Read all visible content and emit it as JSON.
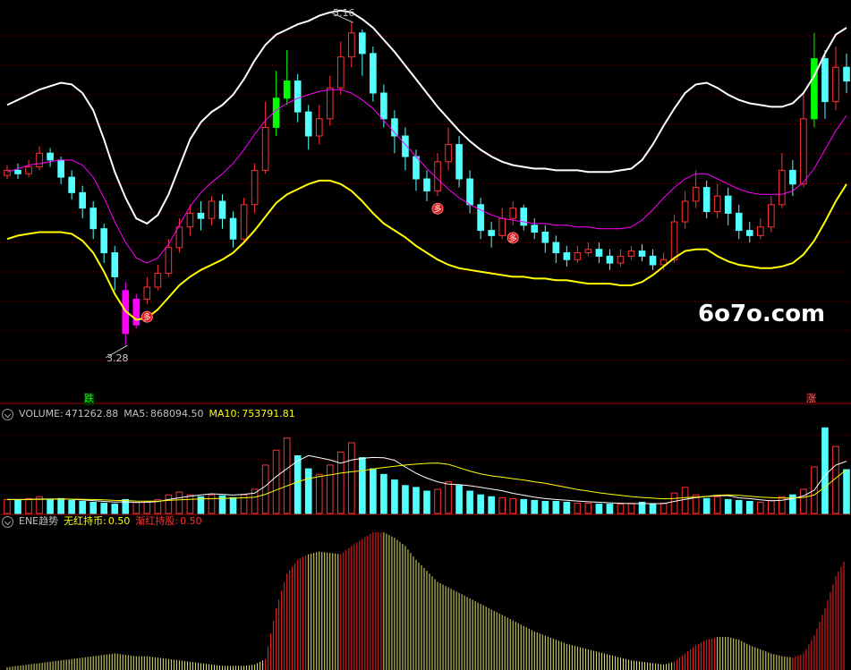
{
  "watermark": "6o7o.com",
  "price_panel": {
    "high_label": "5.16",
    "low_label": "3.28",
    "signal_label": "多",
    "fall_label": "跌",
    "rise_label": "涨"
  },
  "volume_panel": {
    "label": "VOLUME:",
    "value": "471262.88",
    "ma5_label": "MA5:",
    "ma5_value": "868094.50",
    "ma10_label": "MA10:",
    "ma10_value": "753791.81"
  },
  "ene_panel": {
    "label": "ENE趋势",
    "item1_label": "无红持币:",
    "item1_value": "0.50",
    "item2_label": "渐红持股:",
    "item2_value": "0.50"
  },
  "colors": {
    "up": "#ff3232",
    "down": "#54ffff",
    "upper_band": "#ffffff",
    "mid_band": "#ff00ff",
    "lower_band": "#ffff00",
    "green_bar": "#00ff00",
    "magenta_bar": "#ff00ff",
    "ma5": "#ffffff",
    "ma10": "#ffff00"
  },
  "chart_data": [
    {
      "type": "candlestick",
      "title": "",
      "price_range": [
        3.0,
        5.25
      ],
      "annotations": [
        {
          "text": "5.16",
          "kind": "high"
        },
        {
          "text": "3.28",
          "kind": "low"
        }
      ],
      "series": [
        {
          "name": "",
          "role": "upper_band",
          "values": [
            4.68,
            4.71,
            4.74,
            4.77,
            4.79,
            4.81,
            4.8,
            4.75,
            4.65,
            4.48,
            4.29,
            4.14,
            4.02,
            3.99,
            4.04,
            4.16,
            4.32,
            4.48,
            4.58,
            4.64,
            4.68,
            4.74,
            4.83,
            4.94,
            5.03,
            5.09,
            5.12,
            5.15,
            5.17,
            5.2,
            5.22,
            5.23,
            5.22,
            5.18,
            5.13,
            5.06,
            4.99,
            4.91,
            4.83,
            4.75,
            4.67,
            4.6,
            4.53,
            4.47,
            4.42,
            4.38,
            4.35,
            4.33,
            4.32,
            4.31,
            4.31,
            4.3,
            4.3,
            4.3,
            4.29,
            4.29,
            4.29,
            4.3,
            4.31,
            4.36,
            4.45,
            4.56,
            4.66,
            4.75,
            4.8,
            4.81,
            4.78,
            4.74,
            4.71,
            4.69,
            4.68,
            4.67,
            4.67,
            4.69,
            4.75,
            4.85,
            4.98,
            5.09,
            5.13
          ]
        },
        {
          "name": "",
          "role": "mid_band",
          "values": [
            4.29,
            4.31,
            4.33,
            4.34,
            4.35,
            4.36,
            4.36,
            4.33,
            4.26,
            4.14,
            4.0,
            3.88,
            3.79,
            3.76,
            3.79,
            3.87,
            3.98,
            4.09,
            4.17,
            4.23,
            4.28,
            4.34,
            4.42,
            4.51,
            4.59,
            4.65,
            4.69,
            4.72,
            4.74,
            4.76,
            4.77,
            4.77,
            4.75,
            4.71,
            4.66,
            4.59,
            4.52,
            4.45,
            4.38,
            4.31,
            4.25,
            4.19,
            4.14,
            4.1,
            4.07,
            4.04,
            4.02,
            4.01,
            4.0,
            3.99,
            3.99,
            3.98,
            3.98,
            3.97,
            3.97,
            3.96,
            3.96,
            3.96,
            3.97,
            4.01,
            4.07,
            4.14,
            4.2,
            4.25,
            4.28,
            4.28,
            4.25,
            4.22,
            4.19,
            4.17,
            4.16,
            4.16,
            4.16,
            4.18,
            4.23,
            4.31,
            4.42,
            4.53,
            4.62
          ]
        },
        {
          "name": "",
          "role": "lower_band",
          "values": [
            3.9,
            3.92,
            3.93,
            3.94,
            3.94,
            3.94,
            3.93,
            3.89,
            3.82,
            3.71,
            3.58,
            3.48,
            3.43,
            3.44,
            3.49,
            3.56,
            3.63,
            3.68,
            3.72,
            3.75,
            3.78,
            3.82,
            3.88,
            3.95,
            4.03,
            4.11,
            4.16,
            4.19,
            4.22,
            4.24,
            4.24,
            4.22,
            4.18,
            4.12,
            4.05,
            3.99,
            3.95,
            3.91,
            3.86,
            3.82,
            3.78,
            3.75,
            3.73,
            3.72,
            3.71,
            3.7,
            3.69,
            3.68,
            3.68,
            3.67,
            3.67,
            3.66,
            3.66,
            3.65,
            3.64,
            3.64,
            3.64,
            3.63,
            3.63,
            3.65,
            3.69,
            3.74,
            3.79,
            3.83,
            3.84,
            3.84,
            3.8,
            3.77,
            3.75,
            3.74,
            3.73,
            3.73,
            3.74,
            3.76,
            3.81,
            3.89,
            4.0,
            4.12,
            4.22
          ]
        }
      ],
      "candles": [
        [
          4.27,
          4.3,
          4.33,
          4.25
        ],
        [
          4.3,
          4.28,
          4.34,
          4.25
        ],
        [
          4.28,
          4.32,
          4.36,
          4.26
        ],
        [
          4.32,
          4.4,
          4.44,
          4.3
        ],
        [
          4.4,
          4.36,
          4.43,
          4.32
        ],
        [
          4.36,
          4.26,
          4.38,
          4.22
        ],
        [
          4.26,
          4.17,
          4.3,
          4.13
        ],
        [
          4.17,
          4.08,
          4.21,
          4.02
        ],
        [
          4.08,
          3.96,
          4.12,
          3.9
        ],
        [
          3.96,
          3.82,
          3.99,
          3.76
        ],
        [
          3.82,
          3.68,
          3.86,
          3.6
        ],
        [
          3.6,
          3.35,
          3.65,
          3.28
        ],
        [
          3.4,
          3.55,
          3.58,
          3.38
        ],
        [
          3.55,
          3.62,
          3.68,
          3.52
        ],
        [
          3.62,
          3.7,
          3.75,
          3.6
        ],
        [
          3.7,
          3.85,
          3.9,
          3.68
        ],
        [
          3.85,
          3.97,
          4.02,
          3.82
        ],
        [
          3.97,
          4.05,
          4.1,
          3.92
        ],
        [
          4.05,
          4.02,
          4.12,
          3.95
        ],
        [
          4.02,
          4.12,
          4.15,
          3.98
        ],
        [
          4.12,
          4.02,
          4.16,
          3.96
        ],
        [
          4.02,
          3.9,
          4.06,
          3.85
        ],
        [
          3.9,
          4.1,
          4.14,
          3.88
        ],
        [
          4.1,
          4.3,
          4.34,
          4.05
        ],
        [
          4.3,
          4.55,
          4.7,
          4.28
        ],
        [
          4.55,
          4.72,
          4.88,
          4.5
        ],
        [
          4.72,
          4.82,
          5.0,
          4.68
        ],
        [
          4.82,
          4.64,
          4.86,
          4.58
        ],
        [
          4.64,
          4.5,
          4.68,
          4.42
        ],
        [
          4.5,
          4.6,
          4.68,
          4.45
        ],
        [
          4.6,
          4.78,
          4.85,
          4.56
        ],
        [
          4.78,
          4.96,
          5.05,
          4.74
        ],
        [
          4.96,
          5.1,
          5.16,
          4.9
        ],
        [
          5.1,
          4.98,
          5.12,
          4.85
        ],
        [
          4.98,
          4.75,
          5.02,
          4.7
        ],
        [
          4.75,
          4.6,
          4.8,
          4.55
        ],
        [
          4.6,
          4.5,
          4.65,
          4.4
        ],
        [
          4.5,
          4.38,
          4.55,
          4.3
        ],
        [
          4.38,
          4.25,
          4.42,
          4.18
        ],
        [
          4.25,
          4.18,
          4.3,
          4.12
        ],
        [
          4.18,
          4.35,
          4.4,
          4.15
        ],
        [
          4.35,
          4.45,
          4.55,
          4.3
        ],
        [
          4.45,
          4.25,
          4.5,
          4.2
        ],
        [
          4.25,
          4.1,
          4.3,
          4.05
        ],
        [
          4.1,
          3.95,
          4.14,
          3.9
        ],
        [
          3.95,
          3.92,
          4.0,
          3.85
        ],
        [
          3.92,
          4.02,
          4.08,
          3.9
        ],
        [
          4.02,
          4.08,
          4.12,
          3.98
        ],
        [
          4.08,
          3.98,
          4.1,
          3.95
        ],
        [
          3.98,
          3.94,
          4.02,
          3.9
        ],
        [
          3.94,
          3.88,
          3.98,
          3.82
        ],
        [
          3.88,
          3.82,
          3.92,
          3.76
        ],
        [
          3.82,
          3.78,
          3.86,
          3.74
        ],
        [
          3.78,
          3.82,
          3.86,
          3.76
        ],
        [
          3.82,
          3.84,
          3.88,
          3.8
        ],
        [
          3.84,
          3.8,
          3.88,
          3.76
        ],
        [
          3.8,
          3.76,
          3.84,
          3.72
        ],
        [
          3.76,
          3.8,
          3.84,
          3.74
        ],
        [
          3.8,
          3.83,
          3.86,
          3.78
        ],
        [
          3.83,
          3.8,
          3.87,
          3.77
        ],
        [
          3.8,
          3.75,
          3.84,
          3.72
        ],
        [
          3.75,
          3.78,
          3.82,
          3.72
        ],
        [
          3.78,
          4.0,
          4.04,
          3.76
        ],
        [
          4.0,
          4.12,
          4.18,
          3.96
        ],
        [
          4.12,
          4.2,
          4.3,
          4.08
        ],
        [
          4.2,
          4.06,
          4.24,
          4.02
        ],
        [
          4.06,
          4.15,
          4.22,
          4.02
        ],
        [
          4.15,
          4.05,
          4.2,
          3.98
        ],
        [
          4.05,
          3.95,
          4.1,
          3.9
        ],
        [
          3.95,
          3.92,
          4.0,
          3.88
        ],
        [
          3.92,
          3.97,
          4.02,
          3.9
        ],
        [
          3.97,
          4.1,
          4.15,
          3.94
        ],
        [
          4.1,
          4.3,
          4.4,
          4.08
        ],
        [
          4.3,
          4.22,
          4.36,
          4.15
        ],
        [
          4.22,
          4.6,
          4.75,
          4.2
        ],
        [
          4.6,
          4.95,
          5.1,
          4.55
        ],
        [
          4.95,
          4.7,
          5.0,
          4.6
        ],
        [
          4.7,
          4.9,
          5.02,
          4.65
        ],
        [
          4.9,
          4.82,
          4.98,
          4.75
        ]
      ],
      "highlighted_bars": [
        {
          "index": 11,
          "color": "magenta"
        },
        {
          "index": 12,
          "color": "magenta"
        },
        {
          "index": 25,
          "color": "green"
        },
        {
          "index": 26,
          "color": "green"
        },
        {
          "index": 75,
          "color": "green"
        }
      ],
      "signal_indices": [
        13,
        40,
        47
      ]
    },
    {
      "type": "bar",
      "title": "VOLUME",
      "ylim": [
        0,
        1000000
      ],
      "values": [
        150,
        140,
        160,
        180,
        150,
        160,
        140,
        130,
        120,
        110,
        100,
        150,
        120,
        130,
        150,
        200,
        230,
        200,
        180,
        200,
        190,
        170,
        200,
        260,
        520,
        680,
        810,
        620,
        480,
        420,
        520,
        660,
        760,
        600,
        480,
        420,
        360,
        300,
        280,
        240,
        260,
        340,
        300,
        240,
        200,
        180,
        170,
        160,
        150,
        140,
        130,
        130,
        120,
        110,
        110,
        100,
        100,
        100,
        110,
        120,
        100,
        110,
        220,
        280,
        200,
        160,
        180,
        150,
        140,
        130,
        120,
        140,
        180,
        200,
        260,
        500,
        920,
        720,
        471
      ],
      "ma5": [
        150,
        150,
        150,
        155,
        155,
        158,
        152,
        145,
        138,
        130,
        122,
        125,
        118,
        120,
        128,
        150,
        168,
        186,
        200,
        212,
        206,
        198,
        206,
        218,
        294,
        396,
        482,
        564,
        622,
        600,
        576,
        540,
        574,
        592,
        602,
        598,
        572,
        500,
        432,
        380,
        340,
        314,
        310,
        298,
        282,
        262,
        244,
        216,
        196,
        176,
        160,
        150,
        142,
        134,
        126,
        120,
        114,
        110,
        106,
        106,
        106,
        106,
        130,
        152,
        170,
        182,
        190,
        192,
        168,
        160,
        146,
        136,
        142,
        162,
        188,
        250,
        412,
        520,
        562
      ],
      "ma10": [
        150,
        150,
        150,
        152,
        153,
        155,
        154,
        152,
        150,
        146,
        140,
        138,
        134,
        132,
        133,
        140,
        146,
        152,
        156,
        160,
        162,
        164,
        168,
        174,
        206,
        252,
        296,
        340,
        374,
        396,
        414,
        434,
        448,
        460,
        478,
        494,
        508,
        520,
        530,
        538,
        542,
        528,
        492,
        456,
        426,
        404,
        390,
        374,
        360,
        340,
        324,
        302,
        280,
        258,
        240,
        222,
        208,
        194,
        182,
        172,
        164,
        158,
        162,
        170,
        176,
        184,
        196,
        200,
        195,
        185,
        176,
        170,
        166,
        166,
        172,
        198,
        284,
        380,
        471
      ]
    },
    {
      "type": "bar",
      "title": "ENE趋势",
      "ylim": [
        0,
        1
      ],
      "values": [
        0.02,
        0.03,
        0.04,
        0.05,
        0.06,
        0.07,
        0.08,
        0.09,
        0.1,
        0.11,
        0.12,
        0.11,
        0.1,
        0.1,
        0.09,
        0.08,
        0.07,
        0.06,
        0.05,
        0.04,
        0.03,
        0.03,
        0.03,
        0.04,
        0.08,
        0.45,
        0.7,
        0.8,
        0.84,
        0.86,
        0.85,
        0.84,
        0.9,
        0.95,
        1.0,
        1.0,
        0.96,
        0.9,
        0.8,
        0.72,
        0.64,
        0.6,
        0.56,
        0.52,
        0.48,
        0.44,
        0.4,
        0.36,
        0.32,
        0.28,
        0.25,
        0.22,
        0.19,
        0.17,
        0.15,
        0.13,
        0.11,
        0.09,
        0.07,
        0.06,
        0.05,
        0.04,
        0.06,
        0.12,
        0.18,
        0.22,
        0.24,
        0.24,
        0.22,
        0.18,
        0.15,
        0.12,
        0.1,
        0.09,
        0.12,
        0.25,
        0.45,
        0.68,
        0.82
      ],
      "colors": [
        "y",
        "y",
        "y",
        "y",
        "y",
        "y",
        "y",
        "y",
        "y",
        "y",
        "y",
        "y",
        "y",
        "y",
        "y",
        "y",
        "y",
        "y",
        "y",
        "y",
        "y",
        "y",
        "y",
        "y",
        "r",
        "r",
        "r",
        "r",
        "y",
        "y",
        "y",
        "r",
        "r",
        "r",
        "r",
        "y",
        "y",
        "y",
        "y",
        "y",
        "y",
        "y",
        "y",
        "y",
        "y",
        "y",
        "y",
        "y",
        "y",
        "y",
        "y",
        "y",
        "y",
        "y",
        "y",
        "y",
        "y",
        "y",
        "y",
        "y",
        "y",
        "y",
        "r",
        "r",
        "r",
        "r",
        "y",
        "y",
        "y",
        "y",
        "y",
        "y",
        "y",
        "r",
        "r",
        "r",
        "r",
        "r",
        "r"
      ]
    }
  ]
}
